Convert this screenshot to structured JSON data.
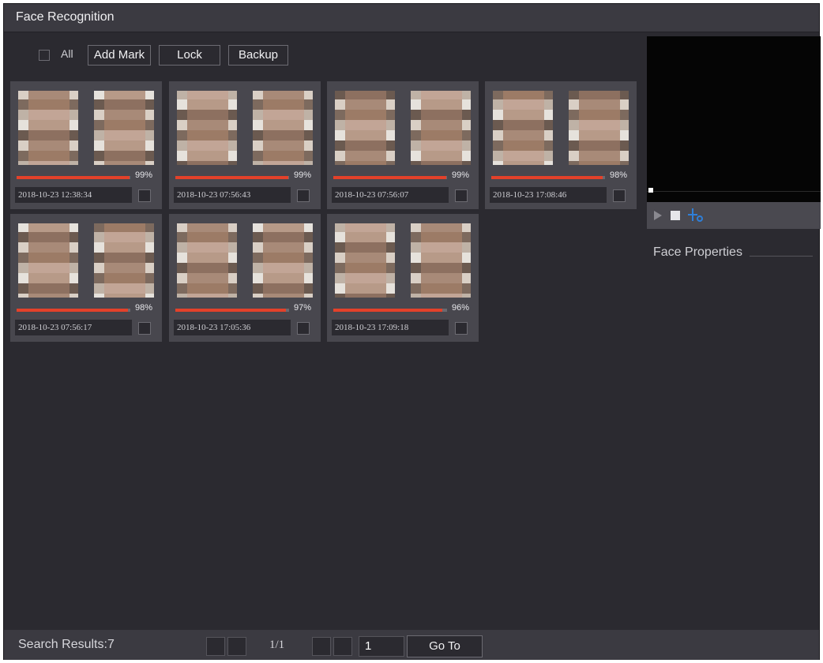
{
  "window": {
    "title": "Face Recognition"
  },
  "toolbar": {
    "all_label": "All",
    "add_mark_label": "Add Mark",
    "lock_label": "Lock",
    "backup_label": "Backup"
  },
  "results": [
    {
      "similarity": 0.99,
      "similarity_label": "99%",
      "timestamp": "2018-10-23 12:38:34"
    },
    {
      "similarity": 0.99,
      "similarity_label": "99%",
      "timestamp": "2018-10-23 07:56:43"
    },
    {
      "similarity": 0.99,
      "similarity_label": "99%",
      "timestamp": "2018-10-23 07:56:07"
    },
    {
      "similarity": 0.98,
      "similarity_label": "98%",
      "timestamp": "2018-10-23 17:08:46"
    },
    {
      "similarity": 0.98,
      "similarity_label": "98%",
      "timestamp": "2018-10-23 07:56:17"
    },
    {
      "similarity": 0.97,
      "similarity_label": "97%",
      "timestamp": "2018-10-23 17:05:36"
    },
    {
      "similarity": 0.96,
      "similarity_label": "96%",
      "timestamp": "2018-10-23 17:09:18"
    }
  ],
  "side_panel": {
    "face_properties_label": "Face Properties"
  },
  "footer": {
    "search_results_label": "Search Results:7",
    "page_indicator": "1/1",
    "page_input_value": "1",
    "goto_label": "Go To"
  },
  "colors": {
    "similarity_bar": "#e3412a",
    "accent_icon": "#2f7fd8"
  }
}
